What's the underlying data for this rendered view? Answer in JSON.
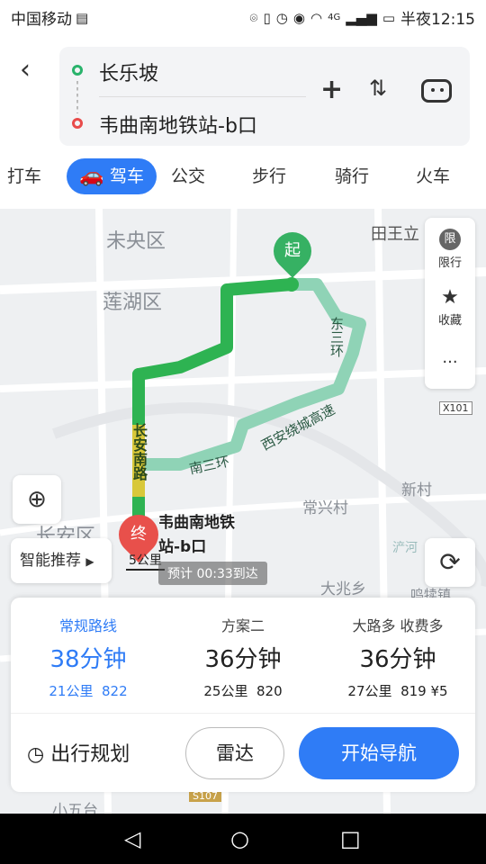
{
  "status": {
    "carrier": "中国移动",
    "network": "4G",
    "time_label": "半夜12:15"
  },
  "header": {
    "start": "长乐坡",
    "end": "韦曲南地铁站-b口"
  },
  "tabs": [
    "打车",
    "驾车",
    "公交",
    "步行",
    "骑行",
    "火车"
  ],
  "map": {
    "districts": [
      "未央区",
      "莲湖区",
      "长安区",
      "田王立",
      "新村",
      "常兴村",
      "大兆乡",
      "小五台",
      "鸣犊镇",
      "浐河"
    ],
    "roads": [
      "长安南路",
      "南三环",
      "西安绕城高速",
      "东三环"
    ],
    "road_badges": [
      "X101",
      "S107"
    ],
    "start_marker": "起",
    "end_marker": "终",
    "dest_name_line1": "韦曲南地铁",
    "dest_name_line2": "站-b口",
    "distance": "5公里",
    "eta": "预计 00:33到达",
    "side": {
      "limit_icon": "限",
      "limit": "限行",
      "favorite": "收藏",
      "more": "···"
    },
    "smart": "智能推荐"
  },
  "plans": [
    {
      "tag": "常规路线",
      "time": "38分钟",
      "km": "21公里",
      "lights": "22",
      "fee": ""
    },
    {
      "tag": "方案二",
      "time": "36分钟",
      "km": "25公里",
      "lights": "20",
      "fee": ""
    },
    {
      "tag": "大路多 收费多",
      "time": "36分钟",
      "km": "27公里",
      "lights": "19",
      "fee": "¥5"
    }
  ],
  "actions": {
    "trip_plan": "出行规划",
    "radar": "雷达",
    "start_nav": "开始导航"
  },
  "colors": {
    "accent": "#2f7cf6",
    "route_main": "#2eb352",
    "route_alt": "#8fd3b6",
    "start": "#36b163",
    "end": "#e8504b"
  }
}
